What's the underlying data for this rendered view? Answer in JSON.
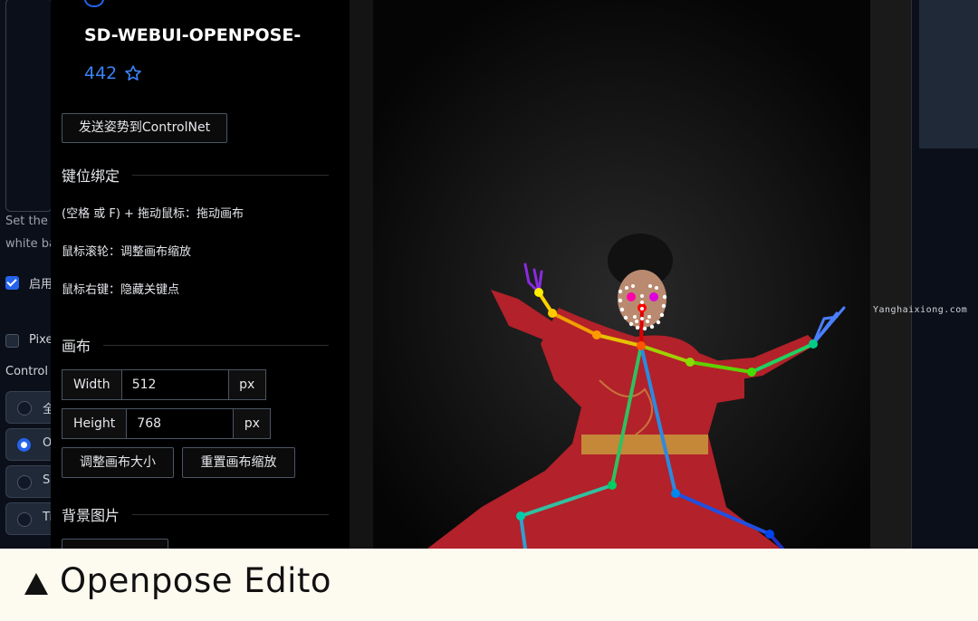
{
  "background": {
    "note_lines": [
      "Set the p",
      "white ba"
    ],
    "checkboxes": [
      {
        "label": "启用",
        "checked": true
      },
      {
        "label": "Pixe",
        "checked": false
      }
    ],
    "control_label": "Control",
    "radios": [
      {
        "label": "全",
        "selected": false
      },
      {
        "label": "O",
        "selected": true
      },
      {
        "label": "Sc",
        "selected": false
      },
      {
        "label": "Ti",
        "selected": false
      }
    ]
  },
  "editor": {
    "title": "SD-WEBUI-OPENPOSE-",
    "star_count": "442",
    "send_button": "发送姿势到ControlNet",
    "keybind_section": "键位绑定",
    "hints": [
      "(空格 或 F) + 拖动鼠标：拖动画布",
      "鼠标滚轮：调整画布缩放",
      "鼠标右键：隐藏关键点"
    ],
    "canvas_section": "画布",
    "width_label": "Width",
    "width_value": "512",
    "height_label": "Height",
    "height_value": "768",
    "unit": "px",
    "resize_button": "调整画布大小",
    "reset_zoom_button": "重置画布缩放",
    "bg_section": "背景图片"
  },
  "watermark": "Yanghaixiong.com",
  "caption": "Openpose Edito",
  "colors": {
    "accent": "#2563eb",
    "caption_bg": "#fdfaf0",
    "robe": "#b3212a"
  }
}
